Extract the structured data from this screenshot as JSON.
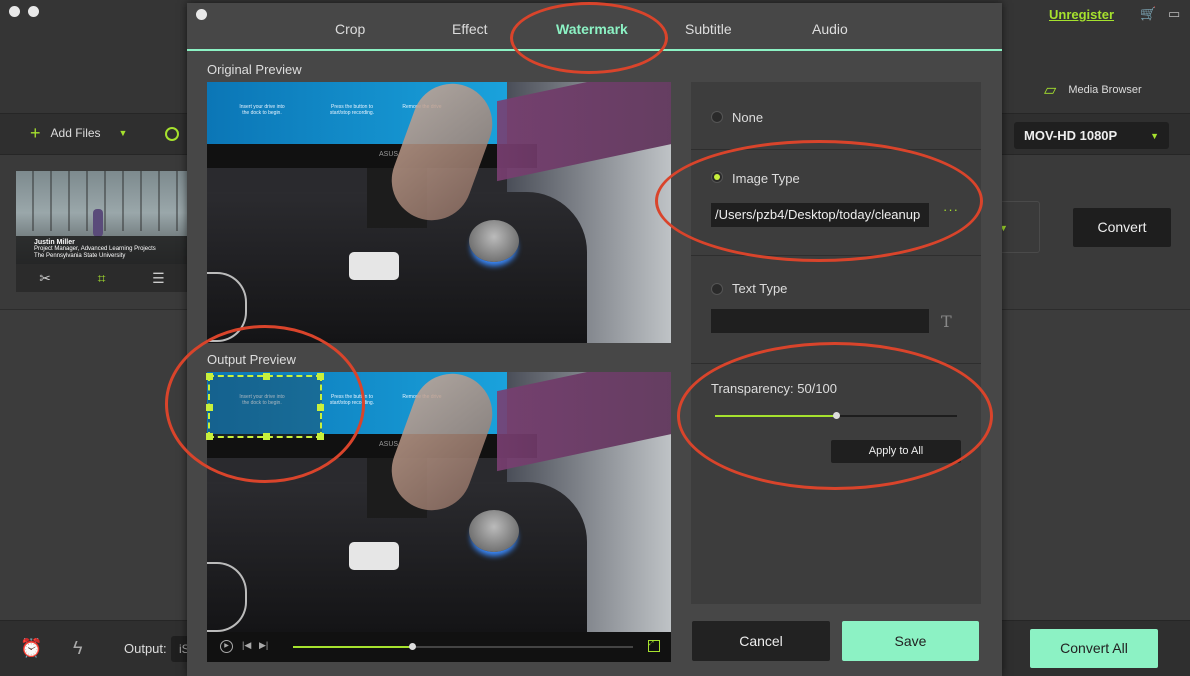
{
  "app": {
    "unregister": "Unregister",
    "media_browser": "Media Browser",
    "add_files": "Add Files",
    "format": "MOV-HD 1080P",
    "convert": "Convert",
    "output_label": "Output:",
    "output_value": "iS",
    "convert_all": "Convert All",
    "thumbnail_caption": {
      "name": "Justin Miller",
      "line1": "Project Manager, Advanced Learning Projects",
      "line2": "The Pennsylvania State University"
    }
  },
  "dialog": {
    "tabs": [
      "Crop",
      "Effect",
      "Watermark",
      "Subtitle",
      "Audio"
    ],
    "active_tab": "Watermark",
    "original_preview_label": "Original Preview",
    "output_preview_label": "Output Preview",
    "screen_texts": [
      "Insert your drive into the dock to begin.",
      "Press the button to start/stop recording.",
      "Remove the drive"
    ],
    "monitor_brand": "ASUS",
    "playback_progress": 0.35,
    "watermark": {
      "none_label": "None",
      "image_type_label": "Image Type",
      "image_path": "/Users/pzb4/Desktop/today/cleanup",
      "browse_label": "···",
      "text_type_label": "Text Type",
      "text_value": "",
      "selected": "Image Type",
      "transparency_label": "Transparency: 50/100",
      "transparency_value": 50,
      "apply_all": "Apply to All"
    },
    "cancel": "Cancel",
    "save": "Save"
  },
  "colors": {
    "accent_green": "#a6e22e",
    "mint": "#8cf2c4",
    "annotation_red": "#d9442b"
  }
}
